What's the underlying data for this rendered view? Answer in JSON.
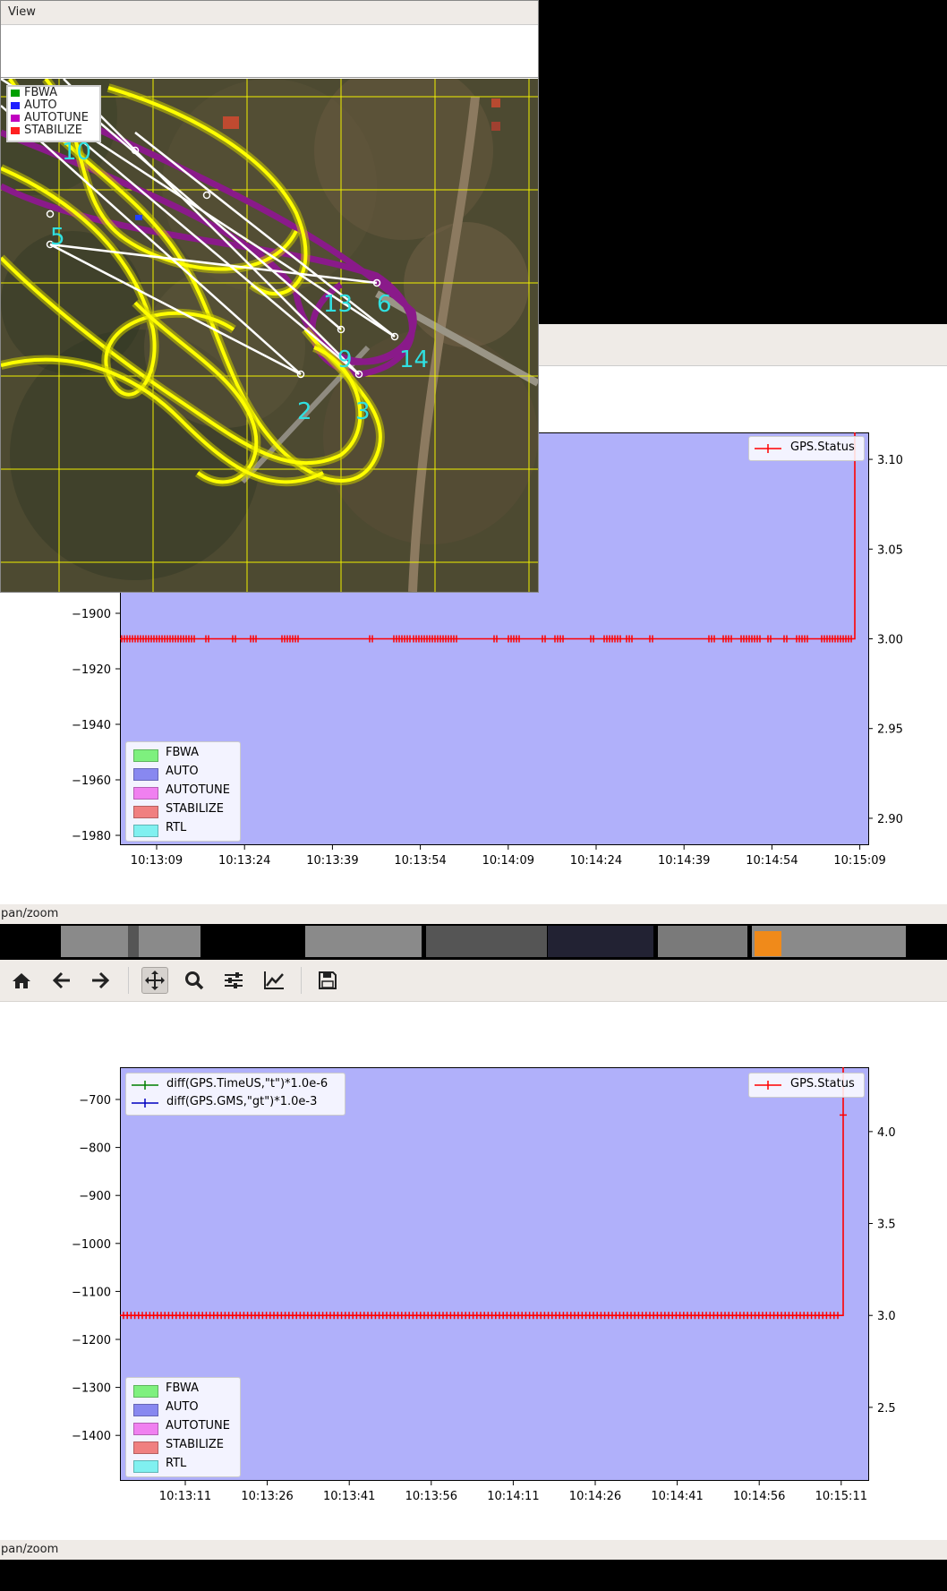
{
  "map_window": {
    "menu": "View",
    "legend": [
      "FBWA",
      "AUTO",
      "AUTOTUNE",
      "STABILIZE"
    ],
    "waypoints": [
      "10",
      "5",
      "13",
      "6",
      "9",
      "14",
      "2",
      "3"
    ]
  },
  "plot1": {
    "status_text": "pan/zoom",
    "legend_right": "GPS.Status",
    "modes": [
      {
        "label": "FBWA",
        "color": "#7ef07e"
      },
      {
        "label": "AUTO",
        "color": "#8888f0"
      },
      {
        "label": "AUTOTUNE",
        "color": "#f080f0"
      },
      {
        "label": "STABILIZE",
        "color": "#f08080"
      },
      {
        "label": "RTL",
        "color": "#80f0f0"
      }
    ],
    "chart_data": {
      "type": "line",
      "x_ticks": [
        "10:13:09",
        "10:13:24",
        "10:13:39",
        "10:13:54",
        "10:14:09",
        "10:14:24",
        "10:14:39",
        "10:14:54",
        "10:15:09"
      ],
      "y_left_ticks": [
        "−1900",
        "−1920",
        "−1940",
        "−1960",
        "−1980"
      ],
      "y_right_ticks": [
        "3.10",
        "3.05",
        "3.00",
        "2.95",
        "2.90"
      ],
      "ylim_right": [
        2.885,
        3.115
      ],
      "series": [
        {
          "name": "GPS.Status",
          "color": "#ff0000",
          "baseline": 3.0,
          "final_value": 3.115
        }
      ]
    }
  },
  "plot2": {
    "status_text": "pan/zoom",
    "legend_right": "GPS.Status",
    "legend_left": [
      {
        "label": "diff(GPS.TimeUS,\"t\")*1.0e-6",
        "color": "#007f00"
      },
      {
        "label": "diff(GPS.GMS,\"gt\")*1.0e-3",
        "color": "#0000bf"
      }
    ],
    "modes": [
      {
        "label": "FBWA",
        "color": "#7ef07e"
      },
      {
        "label": "AUTO",
        "color": "#8888f0"
      },
      {
        "label": "AUTOTUNE",
        "color": "#f080f0"
      },
      {
        "label": "STABILIZE",
        "color": "#f08080"
      },
      {
        "label": "RTL",
        "color": "#80f0f0"
      }
    ],
    "chart_data": {
      "type": "line",
      "x_ticks": [
        "10:13:11",
        "10:13:26",
        "10:13:41",
        "10:13:56",
        "10:14:11",
        "10:14:26",
        "10:14:41",
        "10:14:56",
        "10:15:11"
      ],
      "y_left_ticks": [
        "−700",
        "−800",
        "−900",
        "−1000",
        "−1100",
        "−1200",
        "−1300",
        "−1400"
      ],
      "y_right_ticks": [
        "4.0",
        "3.5",
        "3.0",
        "2.5"
      ],
      "ylim_right": [
        2.1,
        4.35
      ],
      "series": [
        {
          "name": "GPS.Status",
          "color": "#ff0000",
          "baseline": 3.0,
          "final_value": 4.35
        }
      ]
    }
  },
  "toolbar": {
    "icons": [
      "home-icon",
      "back-icon",
      "forward-icon",
      "pan-icon",
      "zoom-icon",
      "configure-icon",
      "axes-icon",
      "save-icon"
    ]
  }
}
